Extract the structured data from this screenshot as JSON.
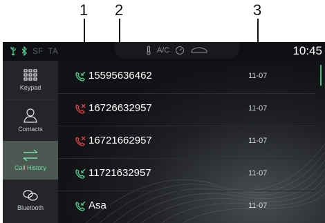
{
  "callouts": [
    "1",
    "2",
    "3"
  ],
  "status": {
    "left_labels": [
      "SF",
      "TA"
    ],
    "ac_label": "A/C",
    "clock": "10:45"
  },
  "sidebar": {
    "items": [
      {
        "label": "Keypad",
        "icon": "keypad-icon",
        "active": false
      },
      {
        "label": "Contacts",
        "icon": "contacts-icon",
        "active": false
      },
      {
        "label": "Call History",
        "icon": "call-history-icon",
        "active": true
      },
      {
        "label": "Bluetooth",
        "icon": "bluetooth-link-icon",
        "active": false
      }
    ]
  },
  "calls": [
    {
      "name": "15595636462",
      "date": "11-07",
      "type": "incoming"
    },
    {
      "name": "16726632957",
      "date": "11-07",
      "type": "missed"
    },
    {
      "name": "16721662957",
      "date": "11-07",
      "type": "missed"
    },
    {
      "name": "11721632957",
      "date": "11-07",
      "type": "incoming"
    },
    {
      "name": "Asa",
      "date": "11-07",
      "type": "incoming"
    }
  ],
  "colors": {
    "accent": "#6ee2a6",
    "incoming": "#4fd18f",
    "missed": "#e0444a",
    "background": "#0c0d10"
  }
}
